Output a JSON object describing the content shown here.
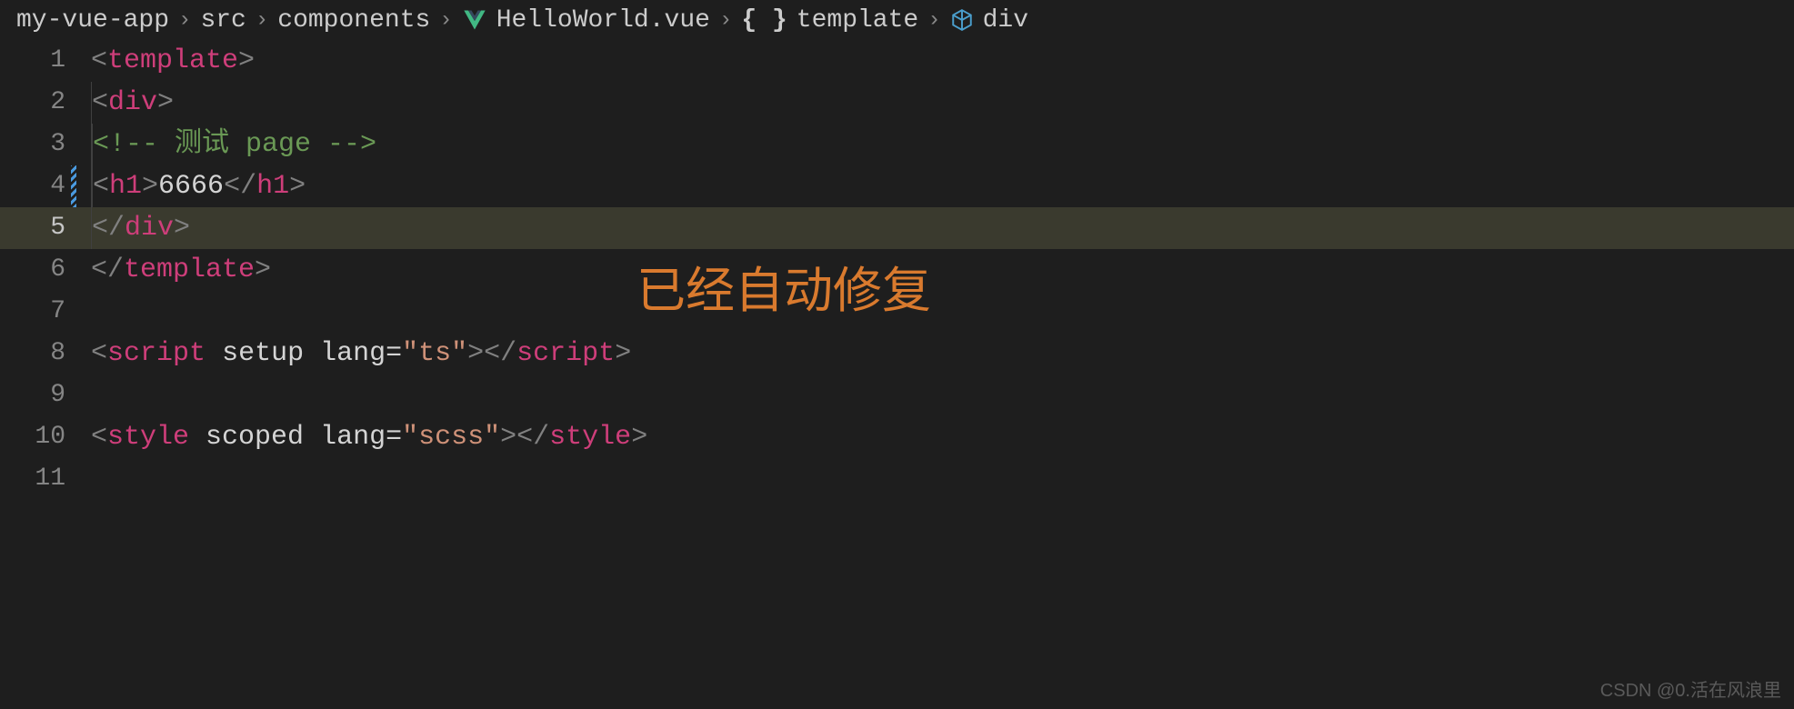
{
  "breadcrumb": {
    "items": [
      "my-vue-app",
      "src",
      "components",
      "HelloWorld.vue",
      "template",
      "div"
    ]
  },
  "lines": {
    "l1": {
      "num": "1",
      "tag": "template"
    },
    "l2": {
      "num": "2",
      "tag": "div"
    },
    "l3": {
      "num": "3",
      "comment_open": "<!--",
      "comment_text": " 测试 page ",
      "comment_close": "-->"
    },
    "l4": {
      "num": "4",
      "tag": "h1",
      "text": "6666"
    },
    "l5": {
      "num": "5",
      "tag": "div"
    },
    "l6": {
      "num": "6",
      "tag": "template"
    },
    "l7": {
      "num": "7"
    },
    "l8": {
      "num": "8",
      "tag": "script",
      "attr1": "setup",
      "attr2": "lang",
      "val2": "\"ts\""
    },
    "l9": {
      "num": "9"
    },
    "l10": {
      "num": "10",
      "tag": "style",
      "attr1": "scoped",
      "attr2": "lang",
      "val2": "\"scss\""
    },
    "l11": {
      "num": "11"
    }
  },
  "annotation": "已经自动修复",
  "watermark": "CSDN @0.活在风浪里"
}
